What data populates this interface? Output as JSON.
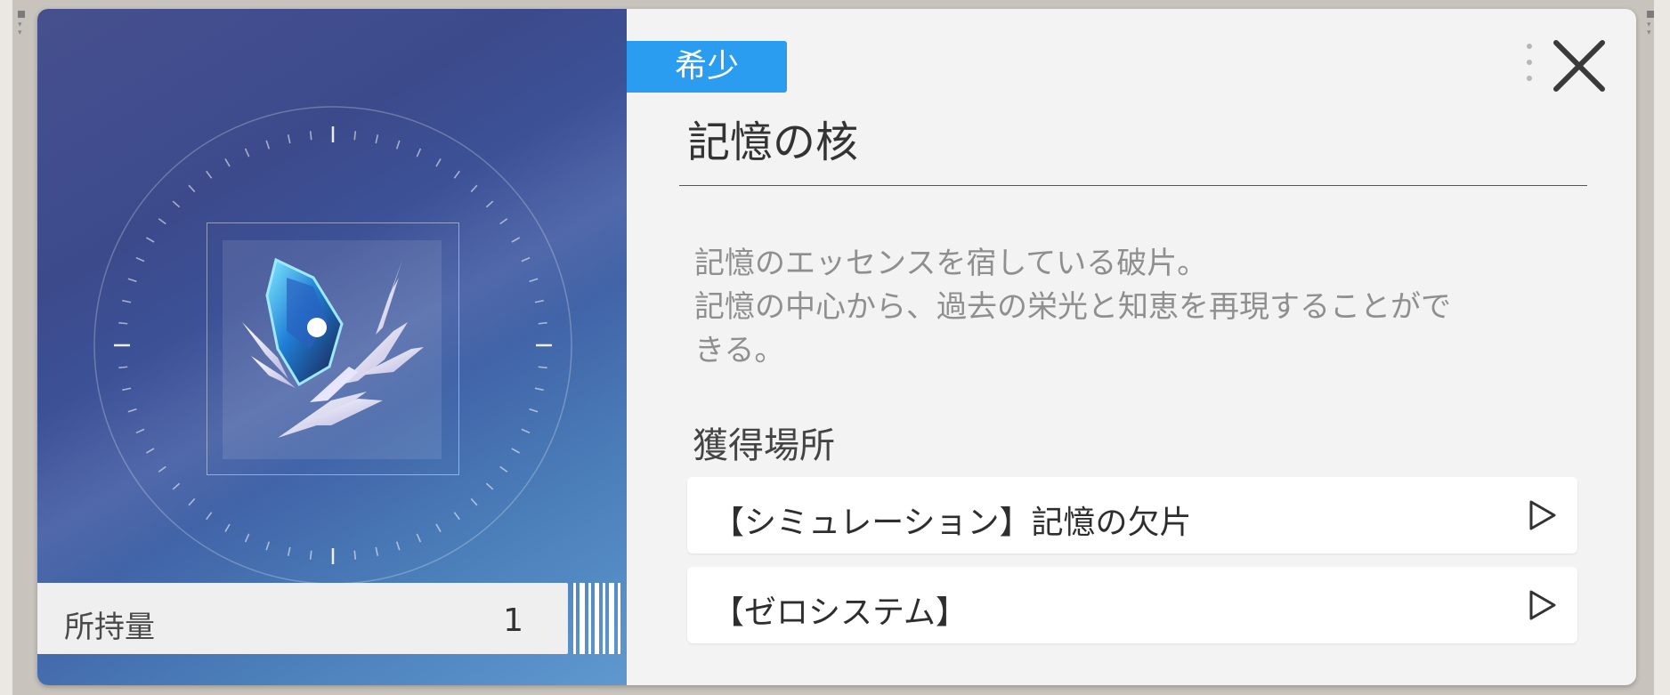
{
  "item": {
    "rarity": "希少",
    "name": "記憶の核",
    "description_lines": [
      "記憶のエッセンスを宿している破片。",
      "記憶の中心から、過去の栄光と知恵を再現することがで",
      "きる。"
    ],
    "quantity_label": "所持量",
    "quantity": "1"
  },
  "acquisition": {
    "heading": "獲得場所",
    "sources": [
      {
        "label": "【シミュレーション】記憶の欠片",
        "icon": "play-icon"
      },
      {
        "label": "【ゼロシステム】",
        "icon": "play-icon"
      }
    ]
  },
  "icons": {
    "close": "close-icon",
    "menu": "menu-dots-icon",
    "item": "memory-core-crystal-icon"
  },
  "colors": {
    "rarity_badge": "#2a9df1",
    "panel_gradient_start": "#46508f",
    "panel_gradient_end": "#5f98cf",
    "dialog_bg": "#f3f3f3"
  }
}
